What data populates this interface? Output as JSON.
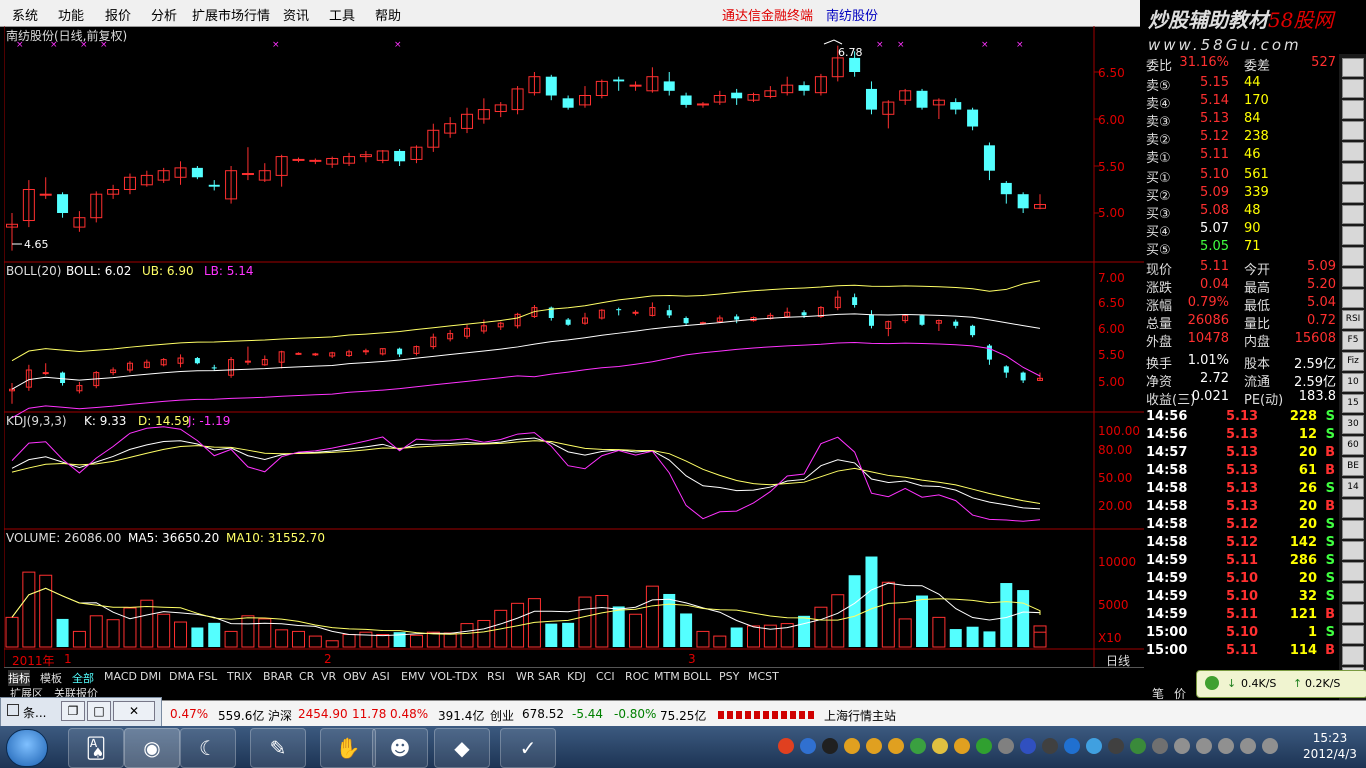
{
  "menu": [
    "系统",
    "功能",
    "报价",
    "分析",
    "扩展市场行情",
    "资讯",
    "工具",
    "帮助"
  ],
  "app_title": "通达信金融终端",
  "stock_title": "南纺股份",
  "banner": {
    "line1_a": "炒股辅助教材",
    "line1_b": "58股网",
    "line2": "www.58Gu.com"
  },
  "main": {
    "label": "南纺股份(日线,前复权)",
    "high_label": "6.78",
    "low_label": "4.65",
    "axis": [
      "6.50",
      "6.00",
      "5.50",
      "5.00"
    ],
    "candles": [
      [
        4.85,
        4.88,
        4.6,
        5.0
      ],
      [
        4.92,
        5.25,
        4.85,
        5.35
      ],
      [
        5.2,
        5.2,
        5.15,
        5.38
      ],
      [
        5.2,
        5.0,
        4.95,
        5.22
      ],
      [
        4.85,
        4.95,
        4.8,
        5.02
      ],
      [
        4.95,
        5.2,
        4.9,
        5.23
      ],
      [
        5.2,
        5.25,
        5.15,
        5.3
      ],
      [
        5.25,
        5.38,
        5.2,
        5.42
      ],
      [
        5.3,
        5.4,
        5.28,
        5.45
      ],
      [
        5.35,
        5.45,
        5.32,
        5.48
      ],
      [
        5.38,
        5.48,
        5.3,
        5.55
      ],
      [
        5.48,
        5.38,
        5.36,
        5.5
      ],
      [
        5.3,
        5.28,
        5.24,
        5.35
      ],
      [
        5.15,
        5.45,
        5.1,
        5.5
      ],
      [
        5.42,
        5.42,
        5.35,
        5.7
      ],
      [
        5.35,
        5.45,
        5.33,
        5.53
      ],
      [
        5.4,
        5.6,
        5.28,
        5.62
      ],
      [
        5.57,
        5.57,
        5.54,
        5.59
      ],
      [
        5.56,
        5.56,
        5.52,
        5.58
      ],
      [
        5.52,
        5.58,
        5.48,
        5.6
      ],
      [
        5.53,
        5.6,
        5.5,
        5.64
      ],
      [
        5.6,
        5.62,
        5.54,
        5.66
      ],
      [
        5.56,
        5.66,
        5.53,
        5.67
      ],
      [
        5.66,
        5.55,
        5.5,
        5.68
      ],
      [
        5.57,
        5.7,
        5.53,
        5.72
      ],
      [
        5.7,
        5.88,
        5.65,
        5.95
      ],
      [
        5.85,
        5.95,
        5.8,
        6.02
      ],
      [
        5.9,
        6.05,
        5.85,
        6.12
      ],
      [
        6.0,
        6.1,
        5.95,
        6.22
      ],
      [
        6.08,
        6.15,
        6.02,
        6.18
      ],
      [
        6.1,
        6.32,
        6.05,
        6.35
      ],
      [
        6.28,
        6.45,
        6.25,
        6.5
      ],
      [
        6.45,
        6.25,
        6.2,
        6.47
      ],
      [
        6.22,
        6.12,
        6.1,
        6.25
      ],
      [
        6.15,
        6.25,
        6.12,
        6.35
      ],
      [
        6.25,
        6.4,
        6.22,
        6.42
      ],
      [
        6.42,
        6.4,
        6.3,
        6.45
      ],
      [
        6.35,
        6.36,
        6.3,
        6.4
      ],
      [
        6.3,
        6.45,
        6.28,
        6.55
      ],
      [
        6.4,
        6.3,
        6.25,
        6.5
      ],
      [
        6.25,
        6.15,
        6.12,
        6.28
      ],
      [
        6.16,
        6.16,
        6.12,
        6.18
      ],
      [
        6.18,
        6.25,
        6.15,
        6.3
      ],
      [
        6.28,
        6.22,
        6.15,
        6.32
      ],
      [
        6.2,
        6.26,
        6.18,
        6.28
      ],
      [
        6.24,
        6.3,
        6.22,
        6.35
      ],
      [
        6.28,
        6.36,
        6.25,
        6.45
      ],
      [
        6.36,
        6.3,
        6.25,
        6.4
      ],
      [
        6.28,
        6.45,
        6.25,
        6.48
      ],
      [
        6.45,
        6.65,
        6.4,
        6.78
      ],
      [
        6.65,
        6.5,
        6.45,
        6.72
      ],
      [
        6.32,
        6.1,
        6.05,
        6.4
      ],
      [
        6.05,
        6.18,
        5.9,
        6.2
      ],
      [
        6.2,
        6.3,
        6.15,
        6.32
      ],
      [
        6.3,
        6.12,
        6.1,
        6.32
      ],
      [
        6.15,
        6.2,
        6.0,
        6.22
      ],
      [
        6.18,
        6.1,
        6.05,
        6.22
      ],
      [
        6.1,
        5.92,
        5.88,
        6.12
      ],
      [
        5.72,
        5.45,
        5.35,
        5.75
      ],
      [
        5.32,
        5.2,
        5.1,
        5.34
      ],
      [
        5.2,
        5.05,
        5.0,
        5.22
      ],
      [
        5.05,
        5.09,
        5.04,
        5.2
      ]
    ]
  },
  "boll": {
    "label_name": "BOLL(20)",
    "boll": "BOLL: 6.02",
    "ub": "UB: 6.90",
    "lb": "LB: 5.14",
    "axis": [
      "7.00",
      "6.50",
      "6.00",
      "5.50",
      "5.00"
    ]
  },
  "kdj": {
    "label_name": "KDJ(9,3,3)",
    "k": "K: 9.33",
    "d": "D: 14.59",
    "j": "J: -1.19",
    "axis": [
      "100.00",
      "80.00",
      "50.00",
      "20.00"
    ]
  },
  "volume": {
    "label_name": "VOLUME: 26086.00",
    "ma5": "MA5: 36650.20",
    "ma10": "MA10: 31552.70",
    "axis": [
      "10000",
      "5000"
    ],
    "unit": "X10",
    "bars": [
      3800,
      9600,
      9200,
      3600,
      2000,
      4000,
      3500,
      5000,
      6000,
      4200,
      3200,
      2500,
      3100,
      2000,
      4000,
      3600,
      2200,
      2000,
      1400,
      800,
      1600,
      1900,
      1600,
      1900,
      1500,
      1900,
      1800,
      3000,
      3400,
      4700,
      5600,
      6200,
      3000,
      3100,
      6400,
      6600,
      5200,
      4200,
      7800,
      6800,
      4300,
      2000,
      1400,
      2500,
      2700,
      2800,
      3000,
      4000,
      5100,
      6700,
      9200,
      11600,
      8300,
      3600,
      6600,
      3800,
      2300,
      2600,
      2000,
      8200,
      7300,
      1900,
      2700
    ]
  },
  "xaxis": [
    "2011年",
    "1",
    "2",
    "3",
    "日线"
  ],
  "quote": {
    "weibi": [
      "委比",
      "31.16%",
      "委差",
      "527"
    ],
    "sells": [
      [
        "卖⑤",
        "5.15",
        "44"
      ],
      [
        "卖④",
        "5.14",
        "170"
      ],
      [
        "卖③",
        "5.13",
        "84"
      ],
      [
        "卖②",
        "5.12",
        "238"
      ],
      [
        "卖①",
        "5.11",
        "46"
      ]
    ],
    "buys": [
      [
        "买①",
        "5.10",
        "561"
      ],
      [
        "买②",
        "5.09",
        "339"
      ],
      [
        "买③",
        "5.08",
        "48"
      ],
      [
        "买④",
        "5.07",
        "90"
      ],
      [
        "买⑤",
        "5.05",
        "71"
      ]
    ],
    "stats": [
      [
        "现价",
        "5.11",
        "今开",
        "5.09"
      ],
      [
        "涨跌",
        "0.04",
        "最高",
        "5.20"
      ],
      [
        "涨幅",
        "0.79%",
        "最低",
        "5.04"
      ],
      [
        "总量",
        "26086",
        "量比",
        "0.72"
      ],
      [
        "外盘",
        "10478",
        "内盘",
        "15608"
      ]
    ],
    "stats2": [
      [
        "换手",
        "1.01%",
        "股本",
        "2.59亿"
      ],
      [
        "净资",
        "2.72",
        "流通",
        "2.59亿"
      ],
      [
        "收益(三)",
        "0.021",
        "PE(动)",
        "183.8"
      ]
    ],
    "ticks": [
      [
        "14:56",
        "5.13",
        "228",
        "S"
      ],
      [
        "14:56",
        "5.13",
        "12",
        "S"
      ],
      [
        "14:57",
        "5.13",
        "20",
        "B"
      ],
      [
        "14:58",
        "5.13",
        "61",
        "B"
      ],
      [
        "14:58",
        "5.13",
        "26",
        "S"
      ],
      [
        "14:58",
        "5.13",
        "20",
        "B"
      ],
      [
        "14:58",
        "5.12",
        "20",
        "S"
      ],
      [
        "14:58",
        "5.12",
        "142",
        "S"
      ],
      [
        "14:59",
        "5.11",
        "286",
        "S"
      ],
      [
        "14:59",
        "5.10",
        "20",
        "S"
      ],
      [
        "14:59",
        "5.10",
        "32",
        "S"
      ],
      [
        "14:59",
        "5.11",
        "121",
        "B"
      ],
      [
        "15:00",
        "5.10",
        "1",
        "S"
      ],
      [
        "15:00",
        "5.11",
        "114",
        "B"
      ]
    ]
  },
  "side_icons": [
    "RSI",
    "F5",
    "Fiz",
    "10",
    "15",
    "30",
    "60",
    "BE",
    "14"
  ],
  "indicator_tabs": [
    "指标",
    "模板",
    "全部",
    "MACD",
    "DMI",
    "DMA",
    "FSL",
    "TRIX",
    "BRAR",
    "CR",
    "VR",
    "OBV",
    "ASI",
    "EMV",
    "VOL-TDX",
    "RSI",
    "WR",
    "SAR",
    "KDJ",
    "CCI",
    "ROC",
    "MTM",
    "BOLL",
    "PSY",
    "MCST"
  ],
  "sub_tabs": [
    "扩展区",
    "关联报价"
  ],
  "bottom_tabs": [
    "笔",
    "价"
  ],
  "float_window": {
    "title": "条..."
  },
  "statusbar": [
    "0.47%",
    "559.6亿",
    "沪深",
    "2454.90",
    "11.78",
    "0.48%",
    "391.4亿",
    "创业",
    "678.52",
    "-5.44",
    "-0.80%",
    "75.25亿",
    "上海行情主站"
  ],
  "speed": {
    "down": "0.4K/S",
    "up": "0.2K/S"
  },
  "clock": {
    "time": "15:23",
    "date": "2012/4/3"
  },
  "colors": {
    "up": "#ff3030",
    "down": "#54ffff",
    "ma_white": "#ffffff",
    "ma_yellow": "#ffff66",
    "ma_purple": "#ff33ff"
  }
}
